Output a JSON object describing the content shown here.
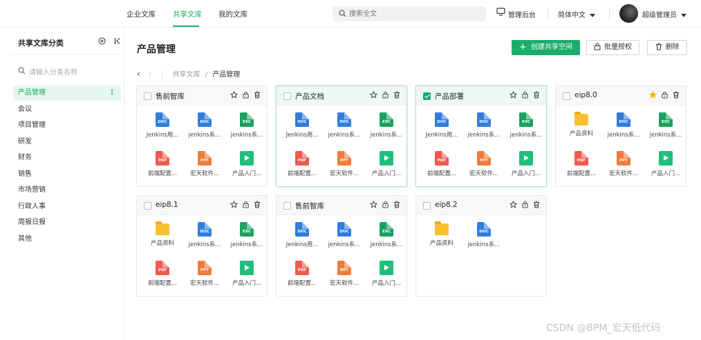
{
  "topbar": {
    "tabs": [
      {
        "label": "企业文库",
        "active": false
      },
      {
        "label": "共享文库",
        "active": true
      },
      {
        "label": "我的文库",
        "active": false
      }
    ],
    "search_placeholder": "搜索全文",
    "admin_label": "管理后台",
    "language_label": "简体中文",
    "user_label": "超级管理员"
  },
  "sidebar": {
    "title": "共享文库分类",
    "search_placeholder": "请输入分类名称",
    "items": [
      {
        "label": "产品管理",
        "active": true
      },
      {
        "label": "会议"
      },
      {
        "label": "项目管理"
      },
      {
        "label": "研发"
      },
      {
        "label": "财务"
      },
      {
        "label": "销售"
      },
      {
        "label": "市场营销"
      },
      {
        "label": "行政人事"
      },
      {
        "label": "周报日报"
      },
      {
        "label": "其他"
      }
    ]
  },
  "main": {
    "title": "产品管理",
    "create_button": "创建共享空间",
    "batch_auth_button": "批量授权",
    "delete_button": "删除",
    "breadcrumb": {
      "root": "共享文库",
      "sep": "/",
      "current": "产品管理"
    }
  },
  "cards": [
    {
      "title": "售前智库",
      "checked": false,
      "starred": false,
      "selected": false,
      "files": [
        {
          "type": "doc",
          "tag": "DOC",
          "name": "Jenkins用..."
        },
        {
          "type": "doc",
          "tag": "DOC",
          "name": "jenkins系..."
        },
        {
          "type": "exc",
          "tag": "EXC",
          "name": "jenkins系..."
        },
        {
          "type": "pdf",
          "tag": "PDF",
          "name": "前端配置..."
        },
        {
          "type": "ppt",
          "tag": "PPT",
          "name": "宏天软件..."
        },
        {
          "type": "vid",
          "tag": "",
          "name": "产品入门..."
        }
      ]
    },
    {
      "title": "产品文档",
      "checked": false,
      "starred": false,
      "selected": true,
      "files": [
        {
          "type": "doc",
          "tag": "DOC",
          "name": "Jenkins用..."
        },
        {
          "type": "doc",
          "tag": "DOC",
          "name": "jenkins系..."
        },
        {
          "type": "exc",
          "tag": "EXC",
          "name": "jenkins系..."
        },
        {
          "type": "pdf",
          "tag": "PDF",
          "name": "前端配置..."
        },
        {
          "type": "ppt",
          "tag": "PPT",
          "name": "宏天软件..."
        },
        {
          "type": "vid",
          "tag": "",
          "name": "产品入门..."
        }
      ]
    },
    {
      "title": "产品部署",
      "checked": true,
      "starred": false,
      "selected": true,
      "files": [
        {
          "type": "doc",
          "tag": "DOC",
          "name": "Jenkins用..."
        },
        {
          "type": "doc",
          "tag": "DOC",
          "name": "jenkins系..."
        },
        {
          "type": "exc",
          "tag": "EXC",
          "name": "jenkins系..."
        },
        {
          "type": "pdf",
          "tag": "PDF",
          "name": "前端配置..."
        },
        {
          "type": "ppt",
          "tag": "PPT",
          "name": "宏天软件..."
        },
        {
          "type": "vid",
          "tag": "",
          "name": "产品入门..."
        }
      ]
    },
    {
      "title": "eip8.0",
      "checked": false,
      "starred": true,
      "selected": false,
      "files": [
        {
          "type": "fld",
          "tag": "",
          "name": "产品资料"
        },
        {
          "type": "doc",
          "tag": "DOC",
          "name": "jenkins系..."
        },
        {
          "type": "exc",
          "tag": "EXC",
          "name": "jenkins系..."
        },
        {
          "type": "pdf",
          "tag": "PDF",
          "name": "前端配置..."
        },
        {
          "type": "ppt",
          "tag": "PPT",
          "name": "宏天软件..."
        },
        {
          "type": "vid",
          "tag": "",
          "name": "产品入门..."
        }
      ]
    },
    {
      "title": "eip8.1",
      "checked": false,
      "starred": false,
      "selected": false,
      "files": [
        {
          "type": "fld",
          "tag": "",
          "name": "产品资料"
        },
        {
          "type": "doc",
          "tag": "DOC",
          "name": "jenkins系..."
        },
        {
          "type": "exc",
          "tag": "EXC",
          "name": "jenkins系..."
        },
        {
          "type": "pdf",
          "tag": "PDF",
          "name": "前端配置..."
        },
        {
          "type": "ppt",
          "tag": "PPT",
          "name": "宏天软件..."
        },
        {
          "type": "vid",
          "tag": "",
          "name": "产品入门..."
        }
      ]
    },
    {
      "title": "售前智库",
      "checked": false,
      "starred": false,
      "selected": false,
      "files": [
        {
          "type": "doc",
          "tag": "DOC",
          "name": "Jenkins用..."
        },
        {
          "type": "doc",
          "tag": "DOC",
          "name": "jenkins系..."
        },
        {
          "type": "exc",
          "tag": "EXC",
          "name": "jenkins系..."
        },
        {
          "type": "pdf",
          "tag": "PDF",
          "name": "前端配置..."
        },
        {
          "type": "ppt",
          "tag": "PPT",
          "name": "宏天软件..."
        },
        {
          "type": "vid",
          "tag": "",
          "name": "产品入门..."
        }
      ]
    },
    {
      "title": "eip8.2",
      "checked": false,
      "starred": false,
      "selected": false,
      "files": [
        {
          "type": "fld",
          "tag": "",
          "name": "产品资料"
        },
        {
          "type": "doc",
          "tag": "DOC",
          "name": "jenkins系..."
        }
      ]
    }
  ],
  "watermark": "CSDN @BPM_宏天低代码",
  "colors": {
    "accent": "#1aad6c",
    "star": "#f5b30b"
  }
}
